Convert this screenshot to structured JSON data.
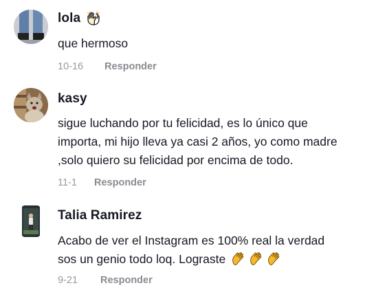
{
  "comments": [
    {
      "username": "lola",
      "text": "que hermoso",
      "date": "10-16",
      "reply_label": "Responder",
      "emoji": "raised-hands-icon"
    },
    {
      "username": "kasy",
      "text_lines": [
        "sigue luchando por tu felicidad, es lo único que",
        "importa, mi hijo lleva ya casi 2 años, yo como madre",
        ",solo quiero su felicidad por encima de todo."
      ],
      "date": "11-1",
      "reply_label": "Responder"
    },
    {
      "username": "Talia Ramirez",
      "text_lines": [
        "Acabo de ver el Instagram es 100% real la verdad",
        "sos un genio todo loq. Lograste"
      ],
      "trailing_emoji": [
        "clapping-hands-icon",
        "clapping-hands-icon",
        "clapping-hands-icon"
      ],
      "date": "9-21",
      "reply_label": "Responder"
    }
  ],
  "colors": {
    "text": "#161823",
    "meta": "#9a9a9e",
    "emoji_yellow": "#f5b82e"
  }
}
